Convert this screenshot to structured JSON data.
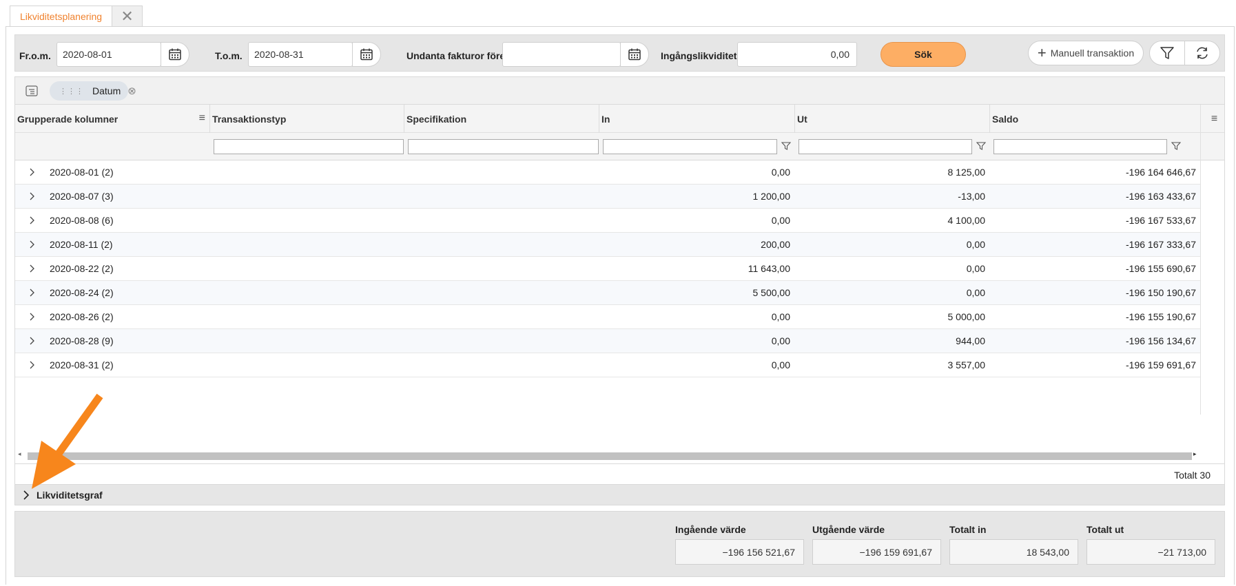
{
  "tabs": {
    "active": "Likviditetsplanering",
    "close_symbol": "✕"
  },
  "toolbar": {
    "from_label": "Fr.o.m.",
    "from_value": "2020-08-01",
    "to_label": "T.o.m.",
    "to_value": "2020-08-31",
    "exclude_label": "Undanta fakturor före",
    "exclude_value": "",
    "opening_label": "Ingångslikviditet",
    "opening_value": "0,00",
    "search_button": "Sök",
    "manual_button": "Manuell transaktion"
  },
  "grid": {
    "group_chip": "Datum",
    "columns": [
      "Grupperade kolumner",
      "Transaktionstyp",
      "Specifikation",
      "In",
      "Ut",
      "Saldo"
    ],
    "rows": [
      {
        "group": "2020-08-01 (2)",
        "in": "0,00",
        "out": "8 125,00",
        "saldo": "-196 164 646,67"
      },
      {
        "group": "2020-08-07 (3)",
        "in": "1 200,00",
        "out": "-13,00",
        "saldo": "-196 163 433,67"
      },
      {
        "group": "2020-08-08 (6)",
        "in": "0,00",
        "out": "4 100,00",
        "saldo": "-196 167 533,67"
      },
      {
        "group": "2020-08-11 (2)",
        "in": "200,00",
        "out": "0,00",
        "saldo": "-196 167 333,67"
      },
      {
        "group": "2020-08-22 (2)",
        "in": "11 643,00",
        "out": "0,00",
        "saldo": "-196 155 690,67"
      },
      {
        "group": "2020-08-24 (2)",
        "in": "5 500,00",
        "out": "0,00",
        "saldo": "-196 150 190,67"
      },
      {
        "group": "2020-08-26 (2)",
        "in": "0,00",
        "out": "5 000,00",
        "saldo": "-196 155 190,67"
      },
      {
        "group": "2020-08-28 (9)",
        "in": "0,00",
        "out": "944,00",
        "saldo": "-196 156 134,67"
      },
      {
        "group": "2020-08-31 (2)",
        "in": "0,00",
        "out": "3 557,00",
        "saldo": "-196 159 691,67"
      }
    ],
    "total_text": "Totalt 30"
  },
  "graph_section": {
    "label": "Likviditetsgraf"
  },
  "summary": {
    "opening_label": "Ingående värde",
    "opening_value": "−196 156 521,67",
    "closing_label": "Utgående värde",
    "closing_value": "−196 159 691,67",
    "total_in_label": "Totalt in",
    "total_in_value": "18 543,00",
    "total_out_label": "Totalt ut",
    "total_out_value": "−21 713,00"
  },
  "colors": {
    "accent": "#f0822e",
    "search_button": "#fdae64",
    "arrow": "#f7861c"
  }
}
